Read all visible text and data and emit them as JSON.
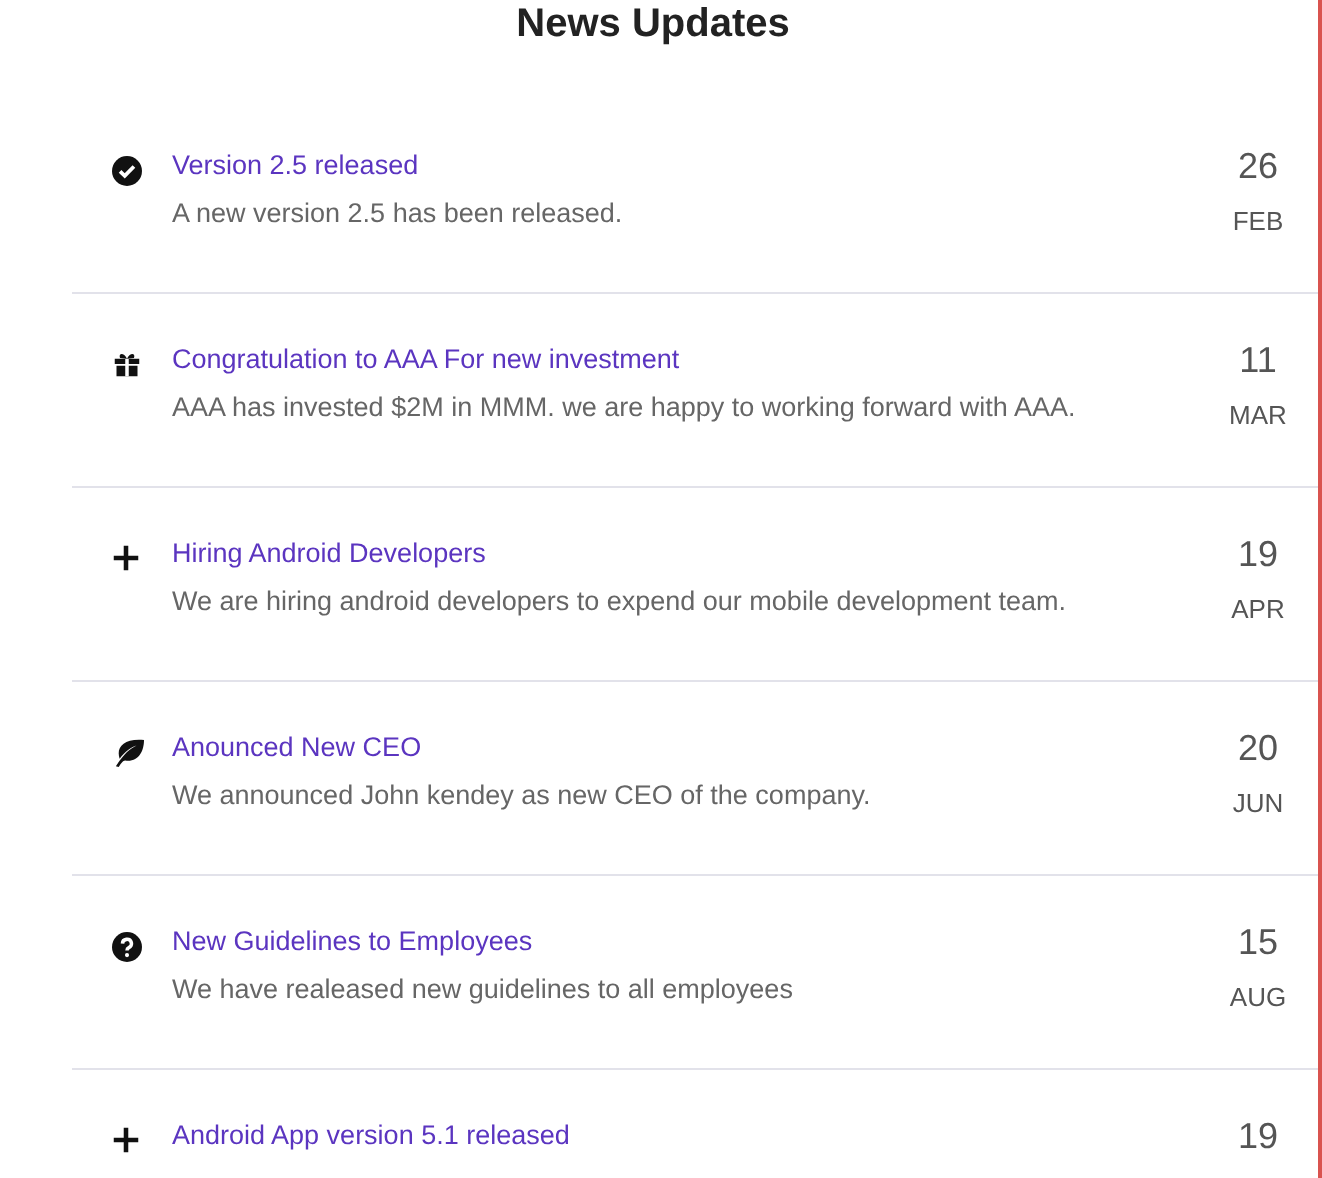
{
  "heading": "News Updates",
  "news": [
    {
      "title": "Version 2.5 released",
      "description": "A new version 2.5 has been released.",
      "day": "26",
      "month": "FEB"
    },
    {
      "title": "Congratulation to AAA For new investment",
      "description": "AAA has invested $2M in MMM. we are happy to working forward with AAA.",
      "day": "11",
      "month": "MAR"
    },
    {
      "title": "Hiring Android Developers",
      "description": "We are hiring android developers to expend our mobile development team.",
      "day": "19",
      "month": "APR"
    },
    {
      "title": "Anounced New CEO",
      "description": "We announced John kendey as new CEO of the company.",
      "day": "20",
      "month": "JUN"
    },
    {
      "title": "New Guidelines to Employees",
      "description": "We have realeased new guidelines to all employees",
      "day": "15",
      "month": "AUG"
    },
    {
      "title": "Android App version 5.1 released",
      "day": "19"
    }
  ]
}
